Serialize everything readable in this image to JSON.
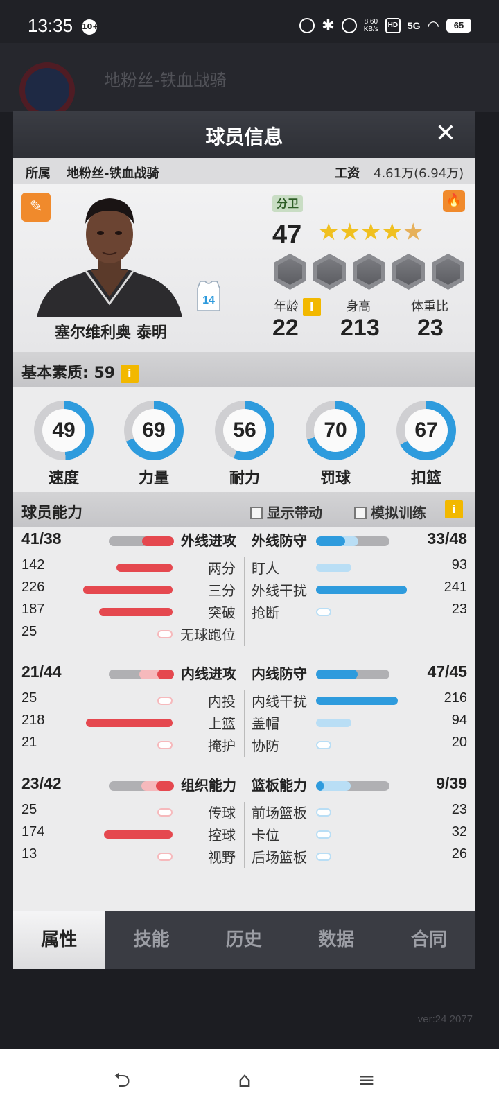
{
  "status_bar": {
    "time": "13:35",
    "notif": "10+",
    "net_speed_top": "8.60",
    "net_speed_unit": "KB/s",
    "hd": "HD",
    "signal": "5G",
    "battery": "65"
  },
  "background": {
    "team_name": "地粉丝-铁血战骑",
    "version": "ver:24  2077"
  },
  "modal": {
    "title": "球员信息",
    "close": "✕",
    "team_label": "所属",
    "team_value": "地粉丝-铁血战骑",
    "salary_label": "工资",
    "salary_value": "4.61万(6.94万)",
    "player": {
      "name": "塞尔维利奥 泰明",
      "jersey_number": "14",
      "position": "分卫",
      "rating": "47",
      "stars": 4.5,
      "age_label": "年龄",
      "age": "22",
      "height_label": "身高",
      "height": "213",
      "weight_ratio_label": "体重比",
      "weight_ratio": "23"
    },
    "basic_quality_title": "基本素质: 59",
    "basics": [
      {
        "label": "速度",
        "value": "49"
      },
      {
        "label": "力量",
        "value": "69"
      },
      {
        "label": "耐力",
        "value": "56"
      },
      {
        "label": "罚球",
        "value": "70"
      },
      {
        "label": "扣篮",
        "value": "67"
      }
    ],
    "ability_title": "球员能力",
    "option_show_lead": "显示带动",
    "option_sim_training": "模拟训练",
    "groups": [
      {
        "left_head": {
          "value": "41/38",
          "name": "外线进攻",
          "bar": [
            0.41,
            0.38
          ]
        },
        "right_head": {
          "value": "33/48",
          "name": "外线防守",
          "bar": [
            0.33,
            0.48
          ]
        },
        "left_rows": [
          {
            "value": "142",
            "name": "两分",
            "bar": 0.58
          },
          {
            "value": "226",
            "name": "三分",
            "bar": 0.92
          },
          {
            "value": "187",
            "name": "突破",
            "bar": 0.76
          },
          {
            "value": "25",
            "name": "无球跑位",
            "bar": 0.1
          }
        ],
        "right_rows": [
          {
            "value": "93",
            "name": "盯人",
            "bar": 0.38
          },
          {
            "value": "241",
            "name": "外线干扰",
            "bar": 0.98
          },
          {
            "value": "23",
            "name": "抢断",
            "bar": 0.09
          }
        ]
      },
      {
        "left_head": {
          "value": "21/44",
          "name": "内线进攻",
          "bar": [
            0.21,
            0.44
          ]
        },
        "right_head": {
          "value": "47/45",
          "name": "内线防守",
          "bar": [
            0.47,
            0.45
          ]
        },
        "left_rows": [
          {
            "value": "25",
            "name": "内投",
            "bar": 0.1
          },
          {
            "value": "218",
            "name": "上篮",
            "bar": 0.89
          },
          {
            "value": "21",
            "name": "掩护",
            "bar": 0.09
          }
        ],
        "right_rows": [
          {
            "value": "216",
            "name": "内线干扰",
            "bar": 0.88
          },
          {
            "value": "94",
            "name": "盖帽",
            "bar": 0.38
          },
          {
            "value": "20",
            "name": "协防",
            "bar": 0.08
          }
        ]
      },
      {
        "left_head": {
          "value": "23/42",
          "name": "组织能力",
          "bar": [
            0.23,
            0.42
          ]
        },
        "right_head": {
          "value": "9/39",
          "name": "篮板能力",
          "bar": [
            0.09,
            0.39
          ]
        },
        "left_rows": [
          {
            "value": "25",
            "name": "传球",
            "bar": 0.1
          },
          {
            "value": "174",
            "name": "控球",
            "bar": 0.71
          },
          {
            "value": "13",
            "name": "视野",
            "bar": 0.06
          }
        ],
        "right_rows": [
          {
            "value": "23",
            "name": "前场篮板",
            "bar": 0.09
          },
          {
            "value": "32",
            "name": "卡位",
            "bar": 0.13
          },
          {
            "value": "26",
            "name": "后场篮板",
            "bar": 0.1
          }
        ]
      }
    ],
    "tabs": [
      "属性",
      "技能",
      "历史",
      "数据",
      "合同"
    ],
    "active_tab": 0
  },
  "colors": {
    "attack_red": "#e5484f",
    "attack_light": "#f6b9bc",
    "defense_blue": "#2e9bdd",
    "defense_light": "#b9def5",
    "gauge_blue": "#2e9bdd",
    "gauge_track": "#cfcfd2",
    "orange": "#f08a2c",
    "info_yellow": "#f2b800"
  },
  "icons": {
    "edit": "edit-user-icon",
    "fire": "fire-icon",
    "info": "info-icon",
    "jersey": "jersey-icon",
    "nav_back": "back-icon",
    "nav_home": "home-icon",
    "nav_menu": "menu-icon"
  }
}
